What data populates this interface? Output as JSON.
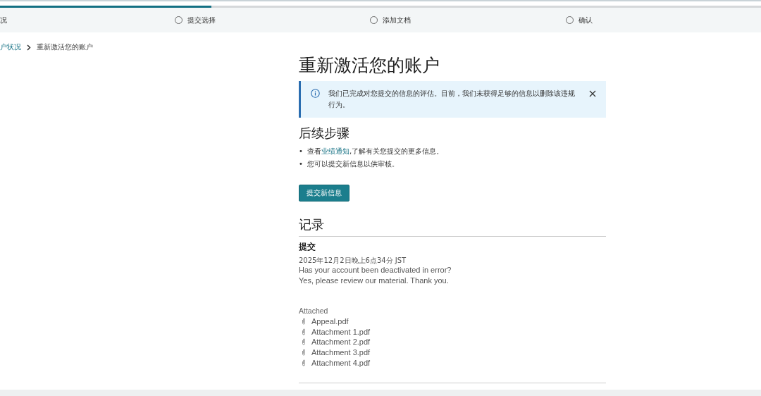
{
  "progress": {
    "level": 0.278
  },
  "steps": [
    {
      "label": "况",
      "kind": "partial"
    },
    {
      "label": "提交选择",
      "kind": "step"
    },
    {
      "label": "添加文档",
      "kind": "step"
    },
    {
      "label": "确认",
      "kind": "step"
    }
  ],
  "breadcrumb": {
    "parent": "户状况",
    "current": "重新激活您的账户"
  },
  "title": "重新激活您的账户",
  "alert": {
    "text": "我们已完成对您提交的信息的评估。目前，我们未获得足够的信息以删除该违规行为。"
  },
  "next_steps": {
    "heading": "后续步骤",
    "items": [
      {
        "bullet": "•",
        "before": "查看",
        "link": "业绩通知",
        "after": ",了解有关您提交的更多信息。"
      },
      {
        "bullet": "•",
        "before": "您可以提交新信息以供审核。"
      }
    ],
    "button": "提交新信息"
  },
  "history": {
    "heading": "记录",
    "entries": [
      {
        "title": "提交",
        "timestamp": "2025年12月2日晚上6点34分 JST",
        "lines": [
          "Has your account been deactivated in error?",
          "Yes, please review our material. Thank you."
        ],
        "attached_label": "Attached",
        "files": [
          "Appeal.pdf",
          "Attachment 1.pdf",
          "Attachment 2.pdf",
          "Attachment 3.pdf",
          "Attachment 4.pdf"
        ]
      }
    ]
  }
}
